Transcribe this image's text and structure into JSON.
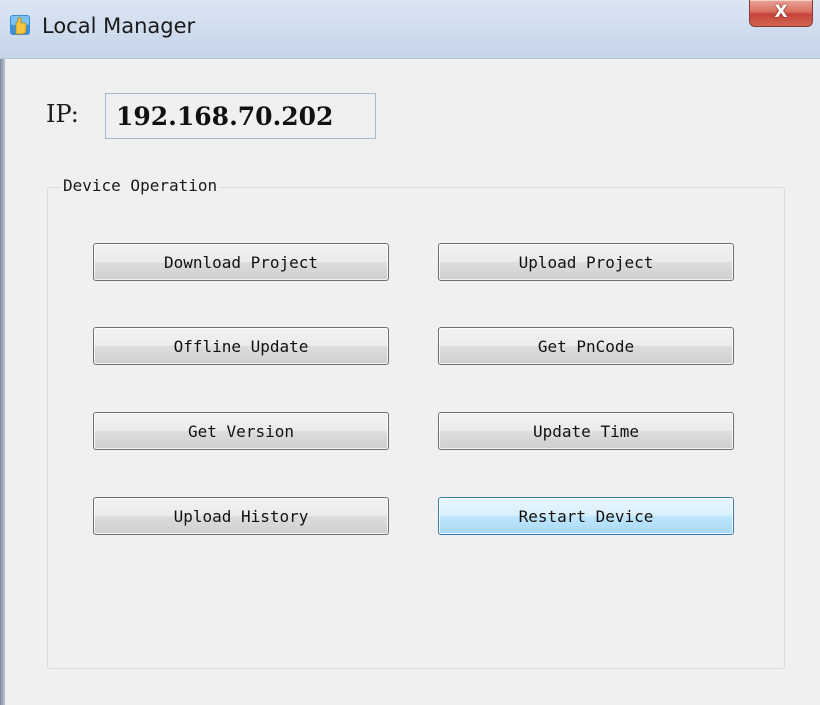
{
  "window": {
    "title": "Local Manager",
    "close_label": "X",
    "icon": "app-hand-icon"
  },
  "ip": {
    "label": "IP:",
    "value": "192.168.70.202"
  },
  "group": {
    "title": "Device Operation",
    "buttons": [
      {
        "label": "Download Project"
      },
      {
        "label": "Upload Project"
      },
      {
        "label": "Offline Update"
      },
      {
        "label": "Get PnCode"
      },
      {
        "label": "Get Version"
      },
      {
        "label": "Update Time"
      },
      {
        "label": "Upload History"
      },
      {
        "label": "Restart Device",
        "focused": true
      }
    ]
  },
  "colors": {
    "titlebar": "#cfdcee",
    "close": "#c5443a",
    "focus": "#bee6fd"
  }
}
